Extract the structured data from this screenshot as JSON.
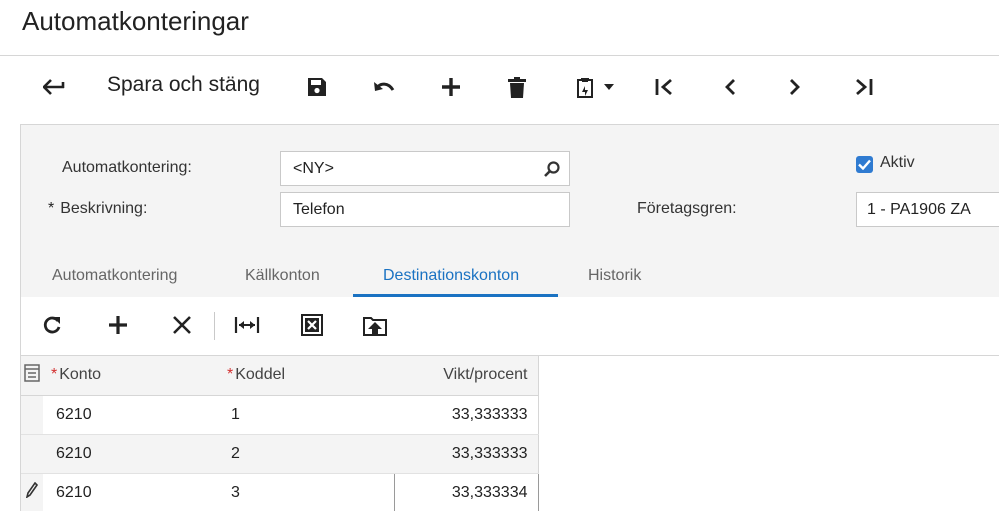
{
  "page": {
    "title": "Automatkonteringar"
  },
  "toolbar": {
    "save_close_label": "Spara och stäng",
    "icons": [
      "back-arrow-icon",
      "save-icon",
      "undo-icon",
      "add-icon",
      "delete-icon",
      "clipboard-icon",
      "first-icon",
      "previous-icon",
      "next-icon",
      "last-icon"
    ]
  },
  "form": {
    "automatkontering_label": "Automatkontering:",
    "automatkontering_value": "<NY>",
    "beskrivning_label": "Beskrivning:",
    "beskrivning_required": "*",
    "beskrivning_value": "Telefon",
    "aktiv_label": "Aktiv",
    "aktiv_checked": true,
    "foretagsgren_label": "Företagsgren:",
    "foretagsgren_value": "1 - PA1906 ZA"
  },
  "tabs": [
    {
      "label": "Automatkontering",
      "active": false
    },
    {
      "label": "Källkonton",
      "active": false
    },
    {
      "label": "Destinationskonton",
      "active": true
    },
    {
      "label": "Historik",
      "active": false
    }
  ],
  "grid": {
    "toolbar_icons": [
      "refresh-icon",
      "add-row-icon",
      "remove-row-icon",
      "fit-columns-icon",
      "export-excel-icon",
      "upload-icon"
    ],
    "columns": [
      {
        "label": "Konto",
        "required": "*"
      },
      {
        "label": "Koddel",
        "required": "*"
      },
      {
        "label": "Vikt/procent"
      }
    ],
    "rows": [
      {
        "konto": "6210",
        "koddel": "1",
        "vikt": "33,333333"
      },
      {
        "konto": "6210",
        "koddel": "2",
        "vikt": "33,333333"
      },
      {
        "konto": "6210",
        "koddel": "3",
        "vikt": "33,333334"
      }
    ]
  },
  "colors": {
    "accent": "#1a72c2",
    "required": "#d32f2f",
    "checkbox": "#2f7bd1"
  }
}
